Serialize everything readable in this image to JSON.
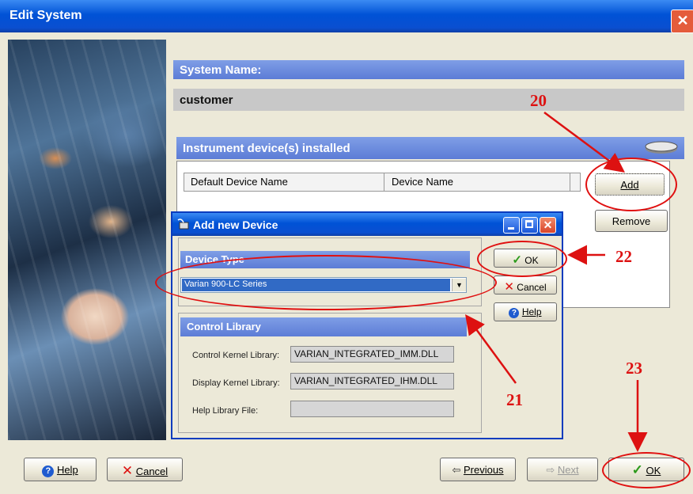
{
  "window": {
    "title": "Edit System",
    "close_icon": "close-icon"
  },
  "system_name": {
    "label": "System Name:",
    "value": "customer"
  },
  "instruments": {
    "header": "Instrument device(s) installed",
    "columns": [
      "Default Device Name",
      "Device Name"
    ],
    "add_label": "Add",
    "remove_label": "Remove"
  },
  "dialog": {
    "title": "Add new Device",
    "device_type_header": "Device Type",
    "device_type_value": "Varian 900-LC Series",
    "control_library_header": "Control Library",
    "control_kernel_label": "Control Kernel Library:",
    "control_kernel_value": "VARIAN_INTEGRATED_IMM.DLL",
    "display_kernel_label": "Display Kernel Library:",
    "display_kernel_value": "VARIAN_INTEGRATED_IHM.DLL",
    "help_file_label": "Help Library File:",
    "help_file_value": "",
    "ok_label": "OK",
    "cancel_label": "Cancel",
    "help_label": "Help"
  },
  "footer": {
    "help_label": "Help",
    "cancel_label": "Cancel",
    "previous_label": "Previous",
    "next_label": "Next",
    "ok_label": "OK"
  },
  "annotations": [
    "20",
    "21",
    "22",
    "23"
  ],
  "colors": {
    "xp_blue": "#0052d6",
    "section_header": "#6f8fe0",
    "annotation_red": "#dd1111"
  }
}
